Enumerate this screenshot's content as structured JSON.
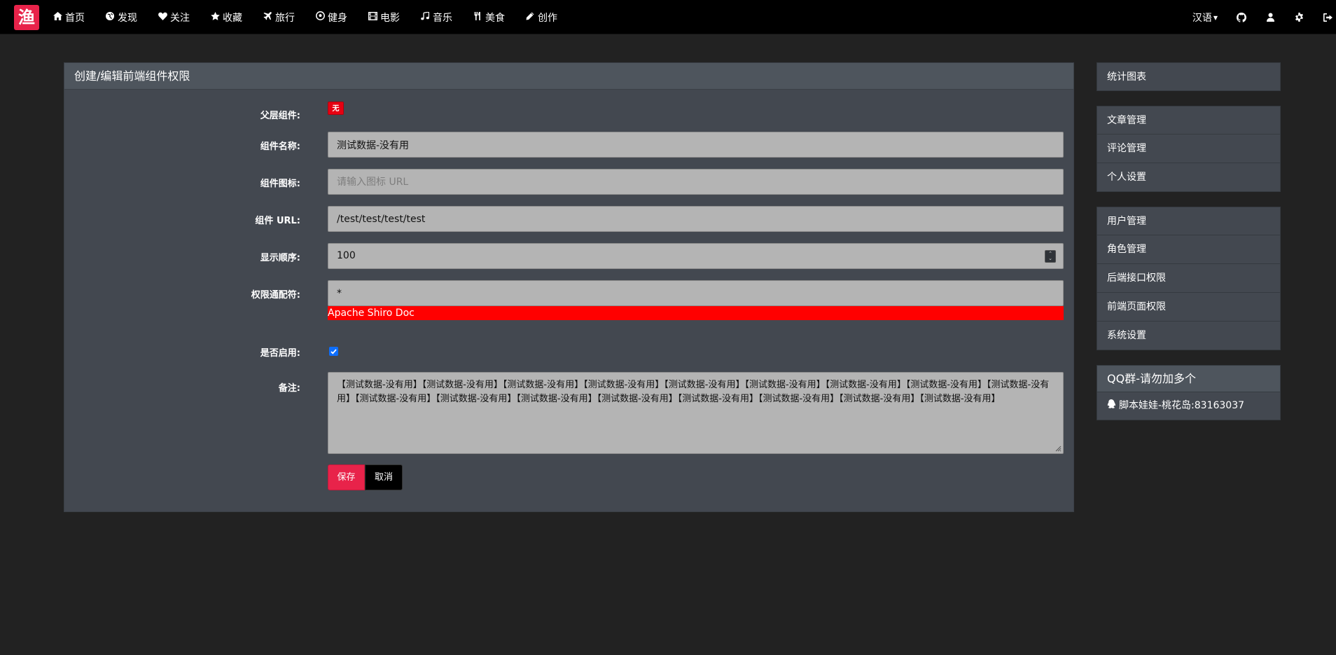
{
  "navbar": {
    "brand": "渔",
    "items": [
      {
        "label": "首页",
        "icon": "home-icon"
      },
      {
        "label": "发现",
        "icon": "globe-icon"
      },
      {
        "label": "关注",
        "icon": "heart-icon"
      },
      {
        "label": "收藏",
        "icon": "star-icon"
      },
      {
        "label": "旅行",
        "icon": "plane-icon"
      },
      {
        "label": "健身",
        "icon": "soccer-ball-icon"
      },
      {
        "label": "电影",
        "icon": "film-icon"
      },
      {
        "label": "音乐",
        "icon": "music-icon"
      },
      {
        "label": "美食",
        "icon": "cutlery-icon"
      },
      {
        "label": "创作",
        "icon": "pencil-icon"
      }
    ],
    "lang": "汉语",
    "right_icons": [
      "github-icon",
      "user-icon",
      "gear-icon",
      "sign-out-icon"
    ]
  },
  "form": {
    "title": "创建/编辑前端组件权限",
    "parent_label": "父层组件:",
    "parent_badge": "无",
    "name_label": "组件名称:",
    "name_value": "测试数据-没有用",
    "icon_label": "组件图标:",
    "icon_placeholder": "请输入图标 URL",
    "url_label": "组件 URL:",
    "url_value": "/test/test/test/test",
    "order_label": "显示顺序:",
    "order_value": "100",
    "perm_label": "权限通配符:",
    "perm_value": "*",
    "doc_link": "Apache Shiro Doc",
    "enabled_label": "是否启用:",
    "enabled": true,
    "note_label": "备注:",
    "note_value": "【测试数据-没有用】【测试数据-没有用】【测试数据-没有用】【测试数据-没有用】【测试数据-没有用】【测试数据-没有用】【测试数据-没有用】【测试数据-没有用】【测试数据-没有用】【测试数据-没有用】【测试数据-没有用】【测试数据-没有用】【测试数据-没有用】【测试数据-没有用】【测试数据-没有用】【测试数据-没有用】【测试数据-没有用】",
    "save_label": "保存",
    "cancel_label": "取消"
  },
  "sidebar": {
    "group1": [
      "统计图表"
    ],
    "group2": [
      "文章管理",
      "评论管理",
      "个人设置"
    ],
    "group3": [
      "用户管理",
      "角色管理",
      "后端接口权限",
      "前端页面权限",
      "系统设置"
    ],
    "qq_title": "QQ群-请勿加多个",
    "qq_group": "脚本娃娃-桃花岛:83163037"
  },
  "colors": {
    "brand": "#e8234a",
    "panel_bg": "#434850",
    "page_bg": "#222222",
    "link_bg": "#ff0000"
  }
}
